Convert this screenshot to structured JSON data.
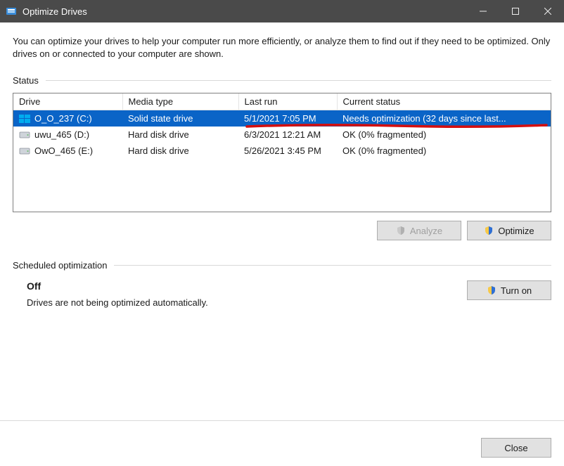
{
  "window": {
    "title": "Optimize Drives"
  },
  "intro": "You can optimize your drives to help your computer run more efficiently, or analyze them to find out if they need to be optimized. Only drives on or connected to your computer are shown.",
  "status_label": "Status",
  "columns": {
    "drive": "Drive",
    "media": "Media type",
    "last_run": "Last run",
    "current_status": "Current status"
  },
  "drives": [
    {
      "name": "O_O_237 (C:)",
      "media": "Solid state drive",
      "last_run": "5/1/2021 7:05 PM",
      "status": "Needs optimization (32 days since last...",
      "selected": true,
      "icon": "windows"
    },
    {
      "name": "uwu_465 (D:)",
      "media": "Hard disk drive",
      "last_run": "6/3/2021 12:21 AM",
      "status": "OK (0% fragmented)",
      "selected": false,
      "icon": "hdd"
    },
    {
      "name": "OwO_465 (E:)",
      "media": "Hard disk drive",
      "last_run": "5/26/2021 3:45 PM",
      "status": "OK (0% fragmented)",
      "selected": false,
      "icon": "hdd"
    }
  ],
  "buttons": {
    "analyze": "Analyze",
    "optimize": "Optimize",
    "turn_on": "Turn on",
    "close": "Close"
  },
  "scheduled": {
    "label": "Scheduled optimization",
    "status": "Off",
    "desc": "Drives are not being optimized automatically."
  },
  "colors": {
    "selection": "#0a64c7",
    "titlebar": "#4a4a4a",
    "annotation": "#d40f0f"
  }
}
